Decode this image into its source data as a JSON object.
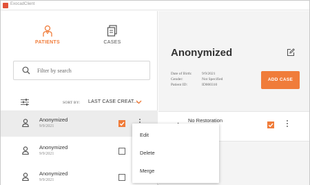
{
  "window": {
    "title": "ExocadClient"
  },
  "nav": {
    "patients_label": "PATIENTS",
    "cases_label": "CASES"
  },
  "search": {
    "placeholder": "Filter by search",
    "value": ""
  },
  "sort": {
    "prefix": "SORT BY:",
    "value": "LAST CASE CREAT..."
  },
  "patients": [
    {
      "name": "Anonymized",
      "date": "9/9/2021",
      "checked": true
    },
    {
      "name": "Anonymized",
      "date": "9/9/2021",
      "checked": false
    },
    {
      "name": "Anonymized",
      "date": "9/9/2021",
      "checked": false
    }
  ],
  "detail": {
    "name": "Anonymized",
    "dob_label": "Date of Birth:",
    "dob_value": "9/9/2021",
    "gender_label": "Gender:",
    "gender_value": "Not Specified",
    "patient_id_label": "Patient ID:",
    "patient_id_value": "ID000310",
    "add_case_label": "ADD CASE"
  },
  "cases": [
    {
      "name": "No Restoration",
      "checked": true
    }
  ],
  "context_menu": {
    "items": [
      "Edit",
      "Delete",
      "Merge"
    ]
  },
  "colors": {
    "accent": "#f07c3a",
    "panel_bg": "#f4f4f4"
  }
}
